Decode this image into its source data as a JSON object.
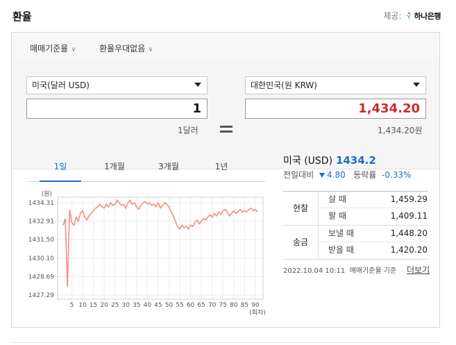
{
  "header": {
    "title": "환율",
    "provider_label": "제공:",
    "provider_name": "하나은행"
  },
  "options": {
    "rate_type": "매매기준율",
    "preferential": "환율우대없음"
  },
  "converter": {
    "from_currency": "미국(달러 USD)",
    "from_amount": "1",
    "from_caption": "1달러",
    "to_currency": "대한민국(원 KRW)",
    "to_amount": "1,434.20",
    "to_caption": "1,434.20원"
  },
  "tabs": [
    {
      "label": "1일",
      "active": true
    },
    {
      "label": "1개월",
      "active": false
    },
    {
      "label": "3개월",
      "active": false
    },
    {
      "label": "1년",
      "active": false
    }
  ],
  "chart_data": {
    "type": "line",
    "ylabel": "(원)",
    "xlabel": "(회차)",
    "ylim": [
      1427.29,
      1434.31
    ],
    "yticks": [
      "1434.31",
      "1432.91",
      "1431.50",
      "1430.10",
      "1428.69",
      "1427.29"
    ],
    "xticks": [
      "5",
      "10",
      "15",
      "20",
      "25",
      "30",
      "35",
      "40",
      "45",
      "50",
      "55",
      "60",
      "65",
      "70",
      "75",
      "80",
      "85",
      "90"
    ],
    "xlim": [
      1,
      91
    ],
    "grid": true,
    "color": "#f0907a",
    "series": [
      {
        "values": [
          1432.6,
          1433.1,
          1427.9,
          1433.8,
          1432.8,
          1432.6,
          1433.2,
          1432.9,
          1433.5,
          1433.7,
          1433.2,
          1433.0,
          1433.3,
          1433.5,
          1433.7,
          1433.9,
          1434.0,
          1434.2,
          1434.0,
          1433.9,
          1434.2,
          1434.0,
          1434.3,
          1434.1,
          1434.2,
          1434.5,
          1434.3,
          1434.1,
          1434.2,
          1433.9,
          1434.3,
          1434.5,
          1434.2,
          1434.3,
          1434.0,
          1433.8,
          1434.1,
          1434.3,
          1434.4,
          1434.2,
          1434.3,
          1434.1,
          1434.2,
          1434.0,
          1434.3,
          1433.9,
          1434.1,
          1434.3,
          1434.2,
          1434.0,
          1433.6,
          1433.3,
          1432.9,
          1432.5,
          1432.3,
          1432.6,
          1432.4,
          1432.5,
          1432.3,
          1432.6,
          1432.5,
          1432.8,
          1433.0,
          1432.7,
          1432.9,
          1433.1,
          1433.0,
          1433.2,
          1433.4,
          1433.2,
          1433.5,
          1433.3,
          1433.6,
          1433.4,
          1433.7,
          1433.8,
          1433.6,
          1433.3,
          1433.5,
          1433.7,
          1433.5,
          1433.6,
          1433.8,
          1433.6,
          1433.7,
          1433.6,
          1433.8,
          1433.9,
          1433.7,
          1433.8,
          1433.6
        ]
      }
    ]
  },
  "info": {
    "country": "미국 (USD)",
    "price": "1434.2",
    "change_label": "전일대비",
    "change_value": "4.80",
    "rate_label": "등락률",
    "rate_value": "-0.33%",
    "cash_label": "현찰",
    "buy_label": "살 때",
    "buy_value": "1,459.29",
    "sell_label": "팔 때",
    "sell_value": "1,409.11",
    "remit_label": "송금",
    "send_label": "보낼 때",
    "send_value": "1,448.20",
    "receive_label": "받을 때",
    "receive_value": "1,420.20",
    "timestamp": "2022.10.04 10:11",
    "basis": "매매기준율 기준",
    "more_label": "더보기"
  }
}
